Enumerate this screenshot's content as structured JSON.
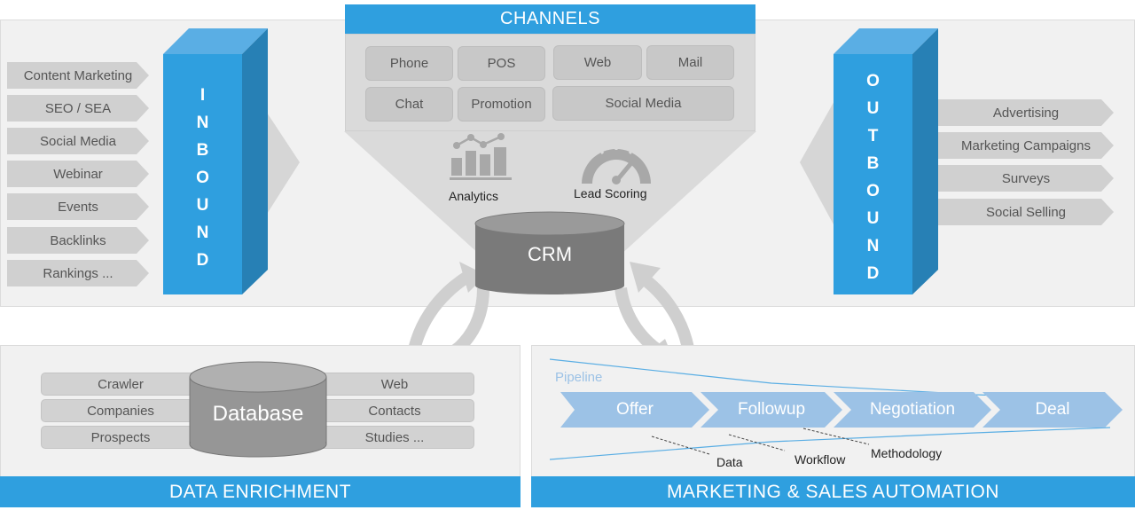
{
  "channels": {
    "title": "CHANNELS",
    "items": [
      "Phone",
      "POS",
      "Web",
      "Mail",
      "Chat",
      "Promotion",
      "Social Media"
    ],
    "analytics_label": "Analytics",
    "lead_scoring_label": "Lead Scoring",
    "crm_label": "CRM"
  },
  "inbound": {
    "title_letters": [
      "I",
      "N",
      "B",
      "O",
      "U",
      "N",
      "D"
    ],
    "items": [
      "Content Marketing",
      "SEO / SEA",
      "Social Media",
      "Webinar",
      "Events",
      "Backlinks",
      "Rankings ..."
    ]
  },
  "outbound": {
    "title_letters": [
      "O",
      "U",
      "T",
      "B",
      "O",
      "U",
      "N",
      "D"
    ],
    "items": [
      "Advertising",
      "Marketing Campaigns",
      "Surveys",
      "Social Selling"
    ]
  },
  "data_enrichment": {
    "title": "DATA ENRICHMENT",
    "database_label": "Database",
    "left_items": [
      "Crawler",
      "Companies",
      "Prospects"
    ],
    "right_items": [
      "Web",
      "Contacts",
      "Studies ..."
    ]
  },
  "automation": {
    "title": "MARKETING & SALES AUTOMATION",
    "pipeline_label": "Pipeline",
    "stages": [
      "Offer",
      "Followup",
      "Negotiation",
      "Deal"
    ],
    "annotations": [
      "Data",
      "Workflow",
      "Methodology"
    ]
  },
  "colors": {
    "accent_blue": "#2f9fdf",
    "pipeline_blue": "#9cc2e6",
    "crm_gray": "#7a7a7a",
    "panel_bg": "#f1f1f1"
  }
}
